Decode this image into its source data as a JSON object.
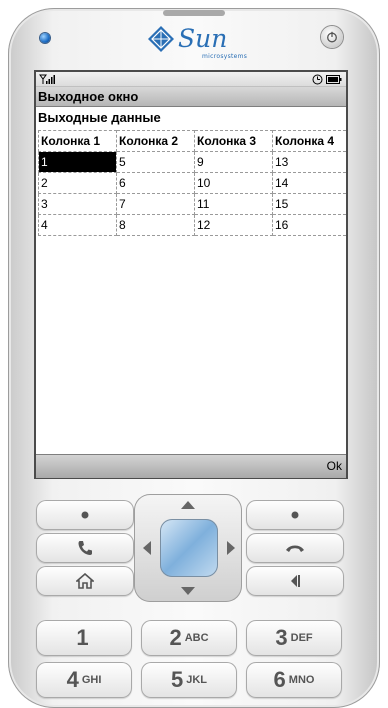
{
  "device": {
    "brand_logo_text": "Sun",
    "brand_sub_text": "microsystems"
  },
  "screen": {
    "title": "Выходное окно",
    "section_label": "Выходные данные",
    "table": {
      "headers": [
        "Колонка 1",
        "Колонка 2",
        "Колонка 3",
        "Колонка 4"
      ],
      "rows": [
        [
          "1",
          "5",
          "9",
          "13"
        ],
        [
          "2",
          "6",
          "10",
          "14"
        ],
        [
          "3",
          "7",
          "11",
          "15"
        ],
        [
          "4",
          "8",
          "12",
          "16"
        ]
      ],
      "selected_cell": "1"
    },
    "softkey_right": "Ok"
  },
  "keypad": {
    "keys": [
      {
        "num": "1",
        "letters": ""
      },
      {
        "num": "2",
        "letters": "ABC"
      },
      {
        "num": "3",
        "letters": "DEF"
      },
      {
        "num": "4",
        "letters": "GHI"
      },
      {
        "num": "5",
        "letters": "JKL"
      },
      {
        "num": "6",
        "letters": "MNO"
      }
    ]
  },
  "colors": {
    "sun_blue": "#2a6fb5",
    "selection": "#000000"
  }
}
